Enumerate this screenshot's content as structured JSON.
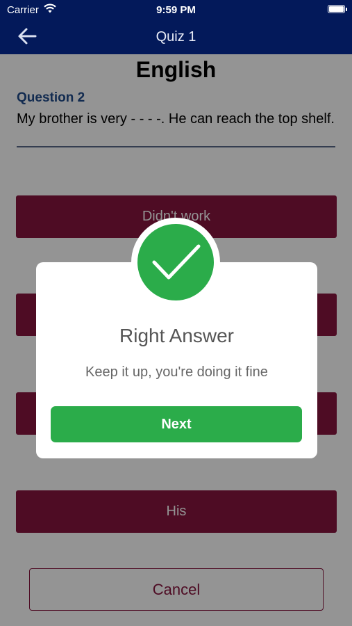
{
  "status_bar": {
    "carrier": "Carrier",
    "time": "9:59 PM"
  },
  "nav": {
    "title": "Quiz 1",
    "back_icon": "arrow-left-icon"
  },
  "quiz": {
    "subject": "English",
    "question_number": "Question 2",
    "question_text": "My brother is very - - - -. He can reach the top shelf."
  },
  "options": [
    {
      "label": "Didn't work"
    },
    {
      "label": ""
    },
    {
      "label": ""
    },
    {
      "label": "His"
    }
  ],
  "cancel_label": "Cancel",
  "dialog": {
    "icon": "checkmark-icon",
    "title": "Right Answer",
    "message": "Keep it up, you're doing it fine",
    "button_label": "Next"
  },
  "colors": {
    "nav_bar": "#03195a",
    "option_button": "#87153f",
    "success": "#2bac4a",
    "question_number": "#1f4a8a"
  }
}
